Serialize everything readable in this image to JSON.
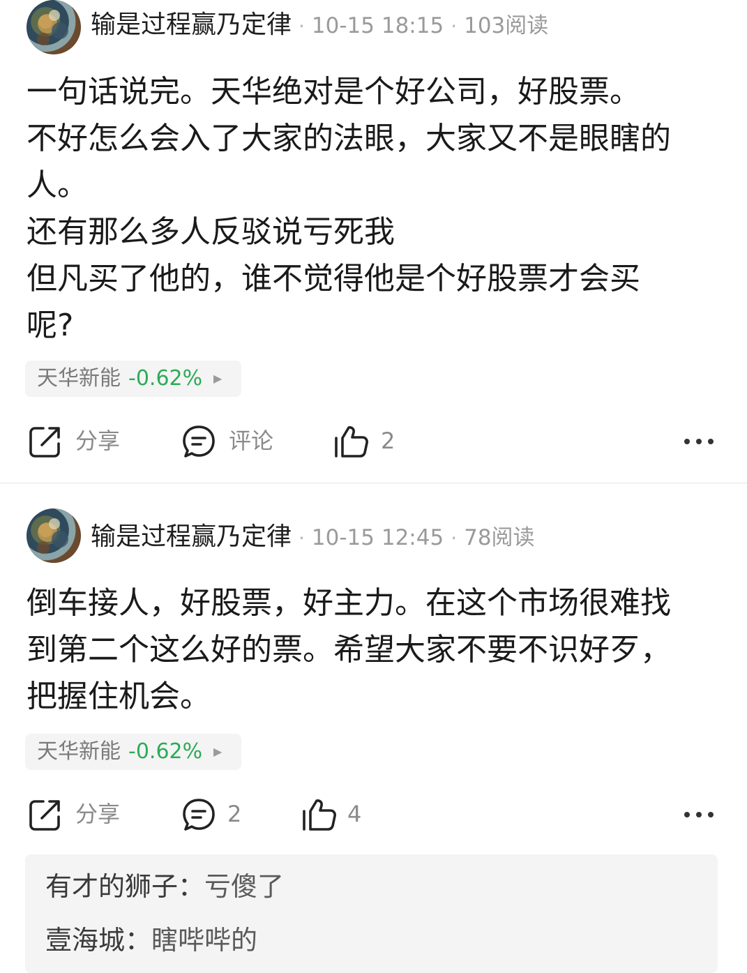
{
  "posts": [
    {
      "author": "输是过程赢乃定律",
      "time": "10-15 18:15",
      "reads": "103阅读",
      "content": [
        "一句话说完。天华绝对是个好公司，好股票。",
        "不好怎么会入了大家的法眼，大家又不是眼瞎的",
        "人。",
        "还有那么多人反驳说亏死我",
        "但凡买了他的，谁不觉得他是个好股票才会买",
        "呢?"
      ],
      "stock": {
        "name": "天华新能",
        "change": "-0.62%"
      },
      "actions": {
        "share": "分享",
        "comment": "评论",
        "like": "2"
      }
    },
    {
      "author": "输是过程赢乃定律",
      "time": "10-15 12:45",
      "reads": "78阅读",
      "content": [
        "倒车接人，好股票，好主力。在这个市场很难找",
        "到第二个这么好的票。希望大家不要不识好歹，",
        "把握住机会。"
      ],
      "stock": {
        "name": "天华新能",
        "change": "-0.62%"
      },
      "actions": {
        "share": "分享",
        "comment": "2",
        "like": "4"
      },
      "comments": [
        {
          "user": "有才的狮子：",
          "text": "亏傻了"
        },
        {
          "user": "壹海城：",
          "text": "瞎哔哔的"
        }
      ]
    }
  ],
  "colors": {
    "stock_down": "#2cab57",
    "meta": "#9a9a9a",
    "tag_bg": "#f4f4f4"
  },
  "icons": [
    "share-icon",
    "comment-icon",
    "like-icon",
    "more-icon",
    "play-arrow-icon"
  ]
}
